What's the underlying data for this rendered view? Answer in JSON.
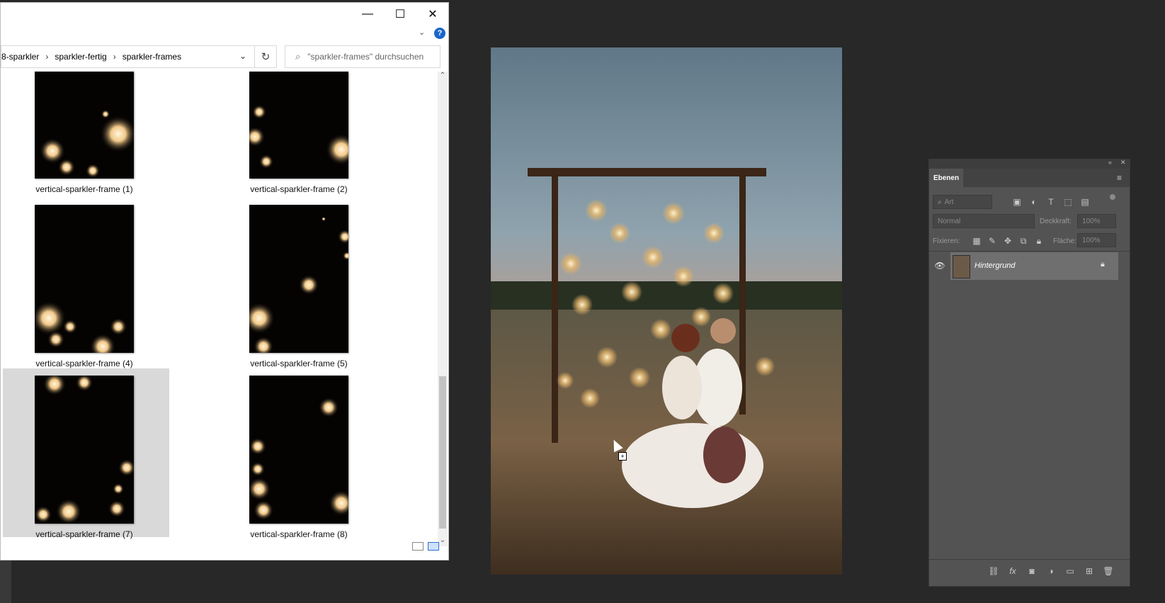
{
  "explorer": {
    "window_controls": {
      "minimize": "—",
      "maximize": "☐",
      "close": "✕"
    },
    "help_icon": "?",
    "breadcrumb": [
      "8-sparkler",
      "sparkler-fertig",
      "sparkler-frames"
    ],
    "search_placeholder": "\"sparkler-frames\" durchsuchen",
    "files": [
      {
        "name": "vertical-sparkler-frame (1)"
      },
      {
        "name": "vertical-sparkler-frame (2)"
      },
      {
        "name": "vertical-sparkler-frame (4)"
      },
      {
        "name": "vertical-sparkler-frame (5)"
      },
      {
        "name": "vertical-sparkler-frame (7)",
        "selected": true
      },
      {
        "name": "vertical-sparkler-frame (8)"
      }
    ]
  },
  "layers_panel": {
    "tab_label": "Ebenen",
    "filter_placeholder": "Art",
    "blend_mode": "Normal",
    "opacity_label": "Deckkraft:",
    "opacity_value": "100%",
    "lock_label": "Fixieren:",
    "fill_label": "Fläche:",
    "fill_value": "100%",
    "layers": [
      {
        "name": "Hintergrund",
        "locked": true,
        "visible": true
      }
    ]
  },
  "colors": {
    "app_bg": "#282828",
    "panel_bg": "#535353",
    "selected_layer": "#6f6f6f",
    "selected_file": "#d9d9d9"
  }
}
